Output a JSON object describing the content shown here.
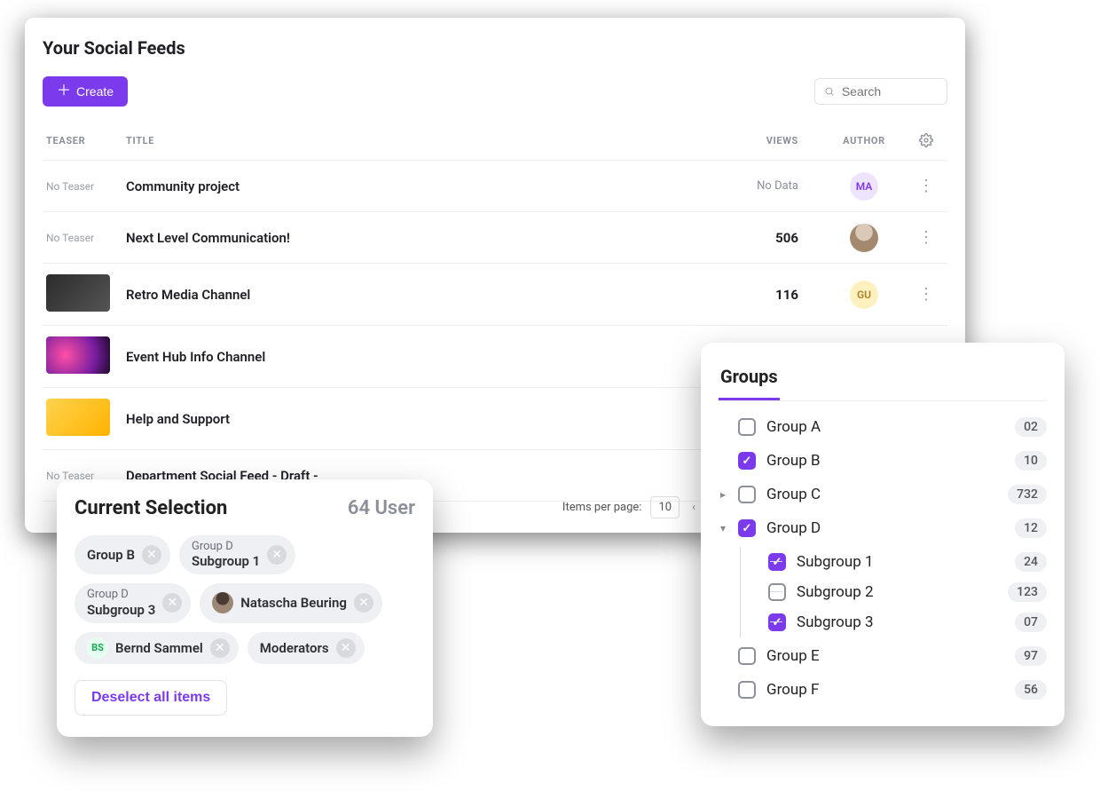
{
  "page": {
    "title": "Your Social Feeds"
  },
  "toolbar": {
    "create_label": "Create",
    "search_placeholder": "Search"
  },
  "table": {
    "columns": {
      "teaser": "TEASER",
      "title": "TITLE",
      "views": "VIEWS",
      "author": "AUTHOR"
    },
    "no_teaser_label": "No Teaser",
    "no_data_label": "No Data",
    "rows": [
      {
        "teaser": "none",
        "title": "Community project",
        "views": "",
        "author_initials": "MA",
        "author_style": "av-ma",
        "views_nodata": true
      },
      {
        "teaser": "none",
        "title": "Next Level Communication!",
        "views": "506",
        "author_initials": "",
        "author_style": "av-photo1",
        "views_nodata": false
      },
      {
        "teaser": "thumb1",
        "title": "Retro Media Channel",
        "views": "116",
        "author_initials": "GU",
        "author_style": "av-gu",
        "views_nodata": false
      },
      {
        "teaser": "thumb2",
        "title": "Event Hub Info Channel",
        "views": "",
        "author_initials": "",
        "author_style": "av-photo2",
        "views_nodata": false
      },
      {
        "teaser": "thumb3",
        "title": "Help and Support",
        "views": "",
        "author_initials": "",
        "author_style": "",
        "views_nodata": false
      },
      {
        "teaser": "none",
        "title": "Department Social Feed - Draft -",
        "views": "",
        "author_initials": "",
        "author_style": "",
        "views_nodata": false
      }
    ]
  },
  "pager": {
    "label": "Items per page:",
    "per_page": "10"
  },
  "selection": {
    "title": "Current Selection",
    "count": "64 User",
    "chips": [
      {
        "sub": "",
        "main": "Group B",
        "avatar": "",
        "av_style": ""
      },
      {
        "sub": "Group D",
        "main": "Subgroup 1",
        "avatar": "",
        "av_style": ""
      },
      {
        "sub": "Group D",
        "main": "Subgroup 3",
        "avatar": "",
        "av_style": ""
      },
      {
        "sub": "",
        "main": "Natascha Beuring",
        "avatar": "photo",
        "av_style": "av-photo3"
      },
      {
        "sub": "",
        "main": "Bernd Sammel",
        "avatar": "BS",
        "av_style": "av-bs"
      },
      {
        "sub": "",
        "main": "Moderators",
        "avatar": "",
        "av_style": ""
      }
    ],
    "deselect_label": "Deselect all items"
  },
  "groups": {
    "tab_label": "Groups",
    "items": [
      {
        "label": "Group A",
        "count": "02",
        "checked": false,
        "expandable": false,
        "children": []
      },
      {
        "label": "Group B",
        "count": "10",
        "checked": true,
        "expandable": false,
        "children": []
      },
      {
        "label": "Group C",
        "count": "732",
        "checked": false,
        "expandable": true,
        "expanded": false,
        "children": []
      },
      {
        "label": "Group D",
        "count": "12",
        "checked": true,
        "expandable": true,
        "expanded": true,
        "children": [
          {
            "label": "Subgroup 1",
            "count": "24",
            "checked": true
          },
          {
            "label": "Subgroup 2",
            "count": "123",
            "checked": false
          },
          {
            "label": "Subgroup 3",
            "count": "07",
            "checked": true
          }
        ]
      },
      {
        "label": "Group E",
        "count": "97",
        "checked": false,
        "expandable": false,
        "children": []
      },
      {
        "label": "Group F",
        "count": "56",
        "checked": false,
        "expandable": false,
        "children": []
      }
    ]
  }
}
